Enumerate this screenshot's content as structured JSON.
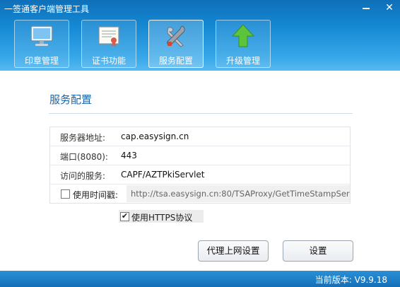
{
  "window": {
    "title": "一签通客户端管理工具"
  },
  "nav": [
    {
      "label": "印章管理",
      "icon": "monitor-icon"
    },
    {
      "label": "证书功能",
      "icon": "certificate-icon"
    },
    {
      "label": "服务配置",
      "icon": "tools-icon"
    },
    {
      "label": "升级管理",
      "icon": "upgrade-arrow-icon"
    }
  ],
  "section": {
    "title": "服务配置"
  },
  "form": {
    "server": {
      "label": "服务器地址:",
      "value": "cap.easysign.cn"
    },
    "port": {
      "label": "端口(8080):",
      "value": "443"
    },
    "service": {
      "label": "访问的服务:",
      "value": "CAPF/AZTPkiServlet"
    },
    "timestamp": {
      "label": "使用时间戳:",
      "checked": false,
      "value": "http://tsa.easysign.cn:80/TSAProxy/GetTimeStampServ"
    }
  },
  "https": {
    "label": "使用HTTPS协议",
    "checked": true,
    "check_mark": "✔"
  },
  "buttons": {
    "proxy": "代理上网设置",
    "save": "设置"
  },
  "footer": {
    "version": "当前版本: V9.9.18"
  },
  "colors": {
    "header_blue": "#1487d2",
    "title_blue": "#1a64a8"
  }
}
